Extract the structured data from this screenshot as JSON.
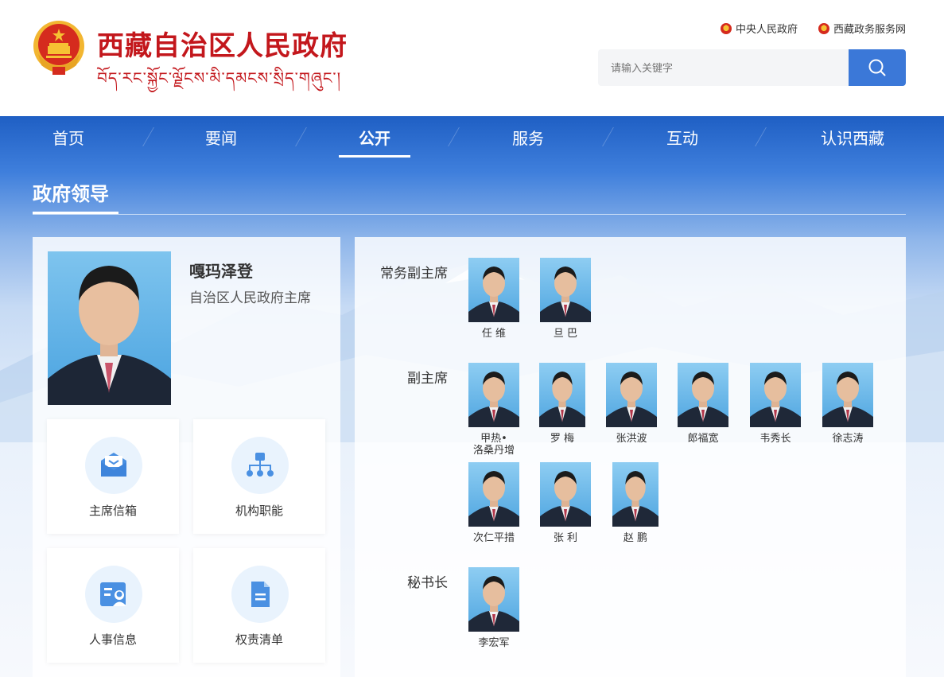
{
  "header": {
    "site_title": "西藏自治区人民政府",
    "tibetan_title": "བོད་རང་སྐྱོང་ལྗོངས་མི་དམངས་སྲིད་གཞུང་།",
    "links": [
      {
        "label": "中央人民政府",
        "icon": "national-emblem-icon"
      },
      {
        "label": "西藏政务服务网",
        "icon": "national-emblem-icon"
      }
    ],
    "search": {
      "placeholder": "请输入关键字",
      "icon": "search-icon"
    }
  },
  "nav": {
    "items": [
      {
        "label": "首页"
      },
      {
        "label": "要闻"
      },
      {
        "label": "公开",
        "active": true
      },
      {
        "label": "服务"
      },
      {
        "label": "互动"
      },
      {
        "label": "认识西藏"
      }
    ]
  },
  "section": {
    "title": "政府领导"
  },
  "chairman": {
    "name": "嘎玛泽登",
    "title": "自治区人民政府主席"
  },
  "tiles": [
    {
      "label": "主席信箱",
      "icon": "mailbox-icon"
    },
    {
      "label": "机构职能",
      "icon": "org-chart-icon"
    },
    {
      "label": "人事信息",
      "icon": "personnel-card-icon"
    },
    {
      "label": "权责清单",
      "icon": "document-list-icon"
    }
  ],
  "leaders": {
    "executive_vice": {
      "label": "常务副主席",
      "people": [
        {
          "name": "任 维"
        },
        {
          "name": "旦 巴"
        }
      ]
    },
    "vice": {
      "label": "副主席",
      "people": [
        {
          "name": "甲热•",
          "name2": "洛桑丹增"
        },
        {
          "name": "罗 梅"
        },
        {
          "name": "张洪波"
        },
        {
          "name": "郎福宽"
        },
        {
          "name": "韦秀长"
        },
        {
          "name": "徐志涛"
        },
        {
          "name": "次仁平措"
        },
        {
          "name": "张 利"
        },
        {
          "name": "赵 鹏"
        }
      ]
    },
    "secretary_general": {
      "label": "秘书长",
      "people": [
        {
          "name": "李宏军"
        }
      ]
    }
  },
  "colors": {
    "brand_red": "#c3171c",
    "nav_blue": "#1f5fc4",
    "search_blue": "#3b78d8"
  }
}
